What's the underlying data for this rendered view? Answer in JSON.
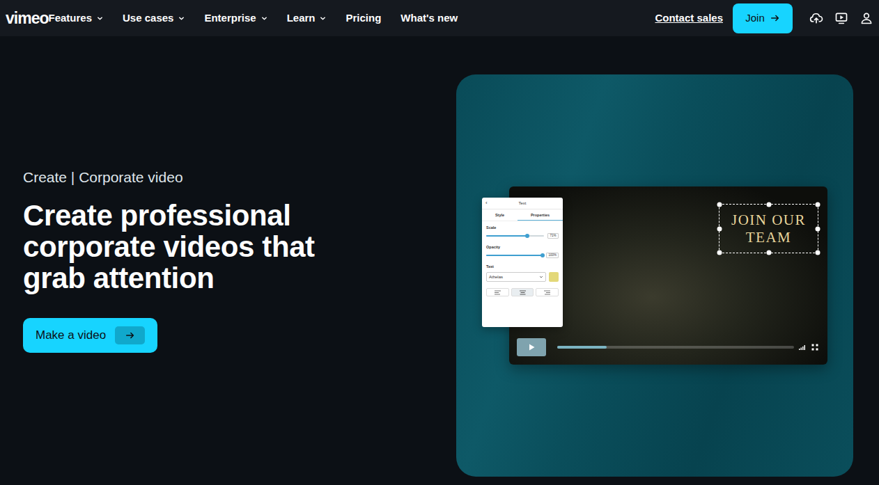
{
  "nav": {
    "logo": "vimeo",
    "links": [
      {
        "label": "Features",
        "dropdown": true
      },
      {
        "label": "Use cases",
        "dropdown": true
      },
      {
        "label": "Enterprise",
        "dropdown": true
      },
      {
        "label": "Learn",
        "dropdown": true
      },
      {
        "label": "Pricing",
        "dropdown": false
      },
      {
        "label": "What's new",
        "dropdown": false
      }
    ],
    "contact": "Contact sales",
    "join": "Join"
  },
  "hero": {
    "eyebrow": "Create | Corporate video",
    "title": "Create professional corporate videos that grab attention",
    "cta": "Make a video"
  },
  "editor": {
    "back": "‹",
    "title": "Text",
    "tabs": [
      {
        "label": "Style",
        "selected": false
      },
      {
        "label": "Properties",
        "selected": true
      }
    ],
    "sliders": [
      {
        "label": "Scale",
        "level": 0.71,
        "reading": "71%"
      },
      {
        "label": "Opacity",
        "level": 1,
        "reading": "100%"
      }
    ],
    "text_section": "Text",
    "font": "Athelas",
    "text_color": "#e3d879",
    "align": [
      {
        "kind": "left",
        "selected": false
      },
      {
        "kind": "center",
        "selected": true
      },
      {
        "kind": "right",
        "selected": false
      }
    ]
  },
  "player": {
    "overlay": {
      "lines": [
        "JOIN OUR",
        "TEAM"
      ],
      "selected": true
    },
    "playing": false,
    "progress": 0.21
  }
}
